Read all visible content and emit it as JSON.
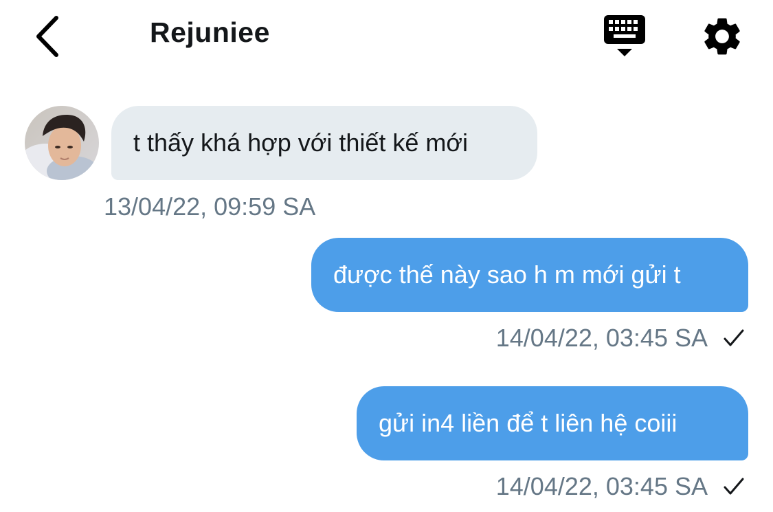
{
  "header": {
    "title": "Rejuniee",
    "back_icon": "chevron-left-icon",
    "keyboard_icon": "keyboard-hide-icon",
    "settings_icon": "gear-icon"
  },
  "messages": [
    {
      "direction": "received",
      "text": "t thấy khá hợp với thiết kế mới",
      "timestamp": "13/04/22, 09:59 SA"
    },
    {
      "direction": "sent",
      "text": "được thế này sao h m mới gửi t",
      "timestamp": "14/04/22, 03:45 SA",
      "status_icon": "checkmark-icon"
    },
    {
      "direction": "sent",
      "text": "gửi in4 liền để t liên hệ coiii",
      "timestamp": "14/04/22, 03:45 SA",
      "status_icon": "checkmark-icon"
    }
  ],
  "colors": {
    "sent_bubble": "#4d9ee9",
    "received_bubble": "#e6ecf0",
    "timestamp": "#657786",
    "text": "#14171a"
  }
}
